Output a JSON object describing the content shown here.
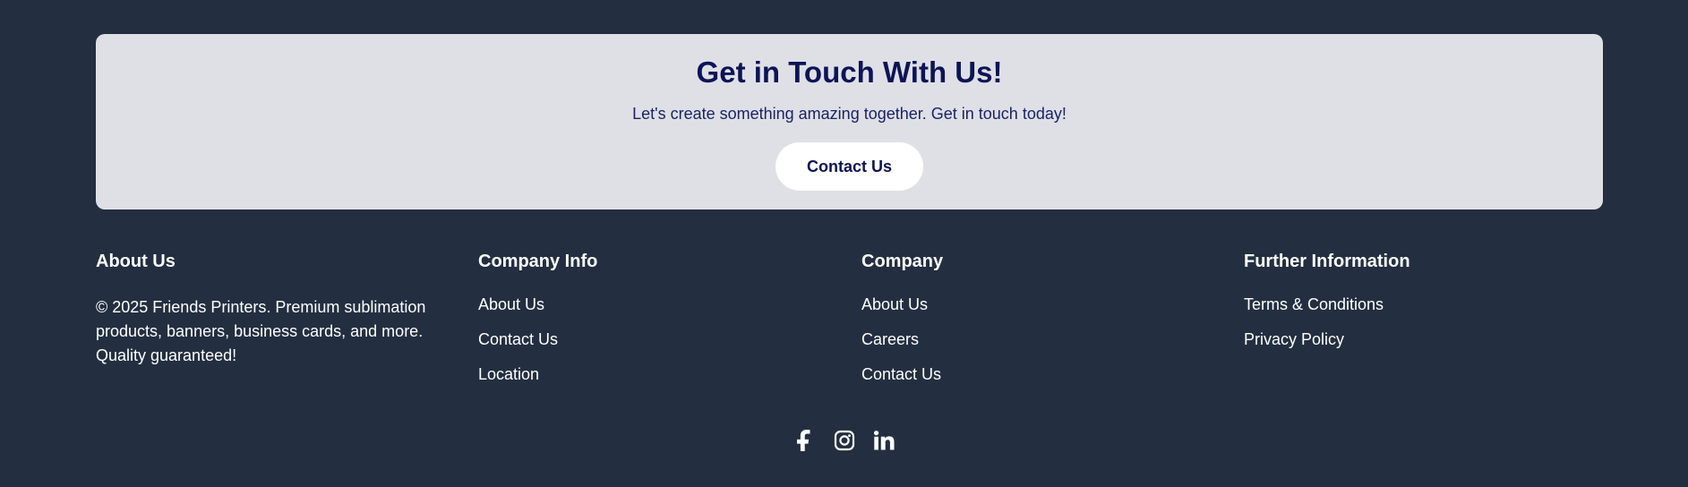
{
  "cta": {
    "title": "Get in Touch With Us!",
    "subtitle": "Let's create something amazing together. Get in touch today!",
    "button_label": "Contact Us"
  },
  "footer": {
    "about": {
      "heading": "About Us",
      "text": "© 2025 Friends Printers. Premium sublimation products, banners, business cards, and more. Quality guaranteed!"
    },
    "company_info": {
      "heading": "Company Info",
      "links": [
        "About Us",
        "Contact Us",
        "Location"
      ]
    },
    "company": {
      "heading": "Company",
      "links": [
        "About Us",
        "Careers",
        "Contact Us"
      ]
    },
    "further": {
      "heading": "Further Information",
      "links": [
        "Terms & Conditions",
        "Privacy Policy"
      ]
    }
  },
  "social": {
    "icons": [
      "facebook-icon",
      "instagram-icon",
      "linkedin-icon"
    ]
  },
  "colors": {
    "background": "#232f40",
    "cta_background": "#dfe0e6",
    "brand_navy": "#0d1456"
  }
}
